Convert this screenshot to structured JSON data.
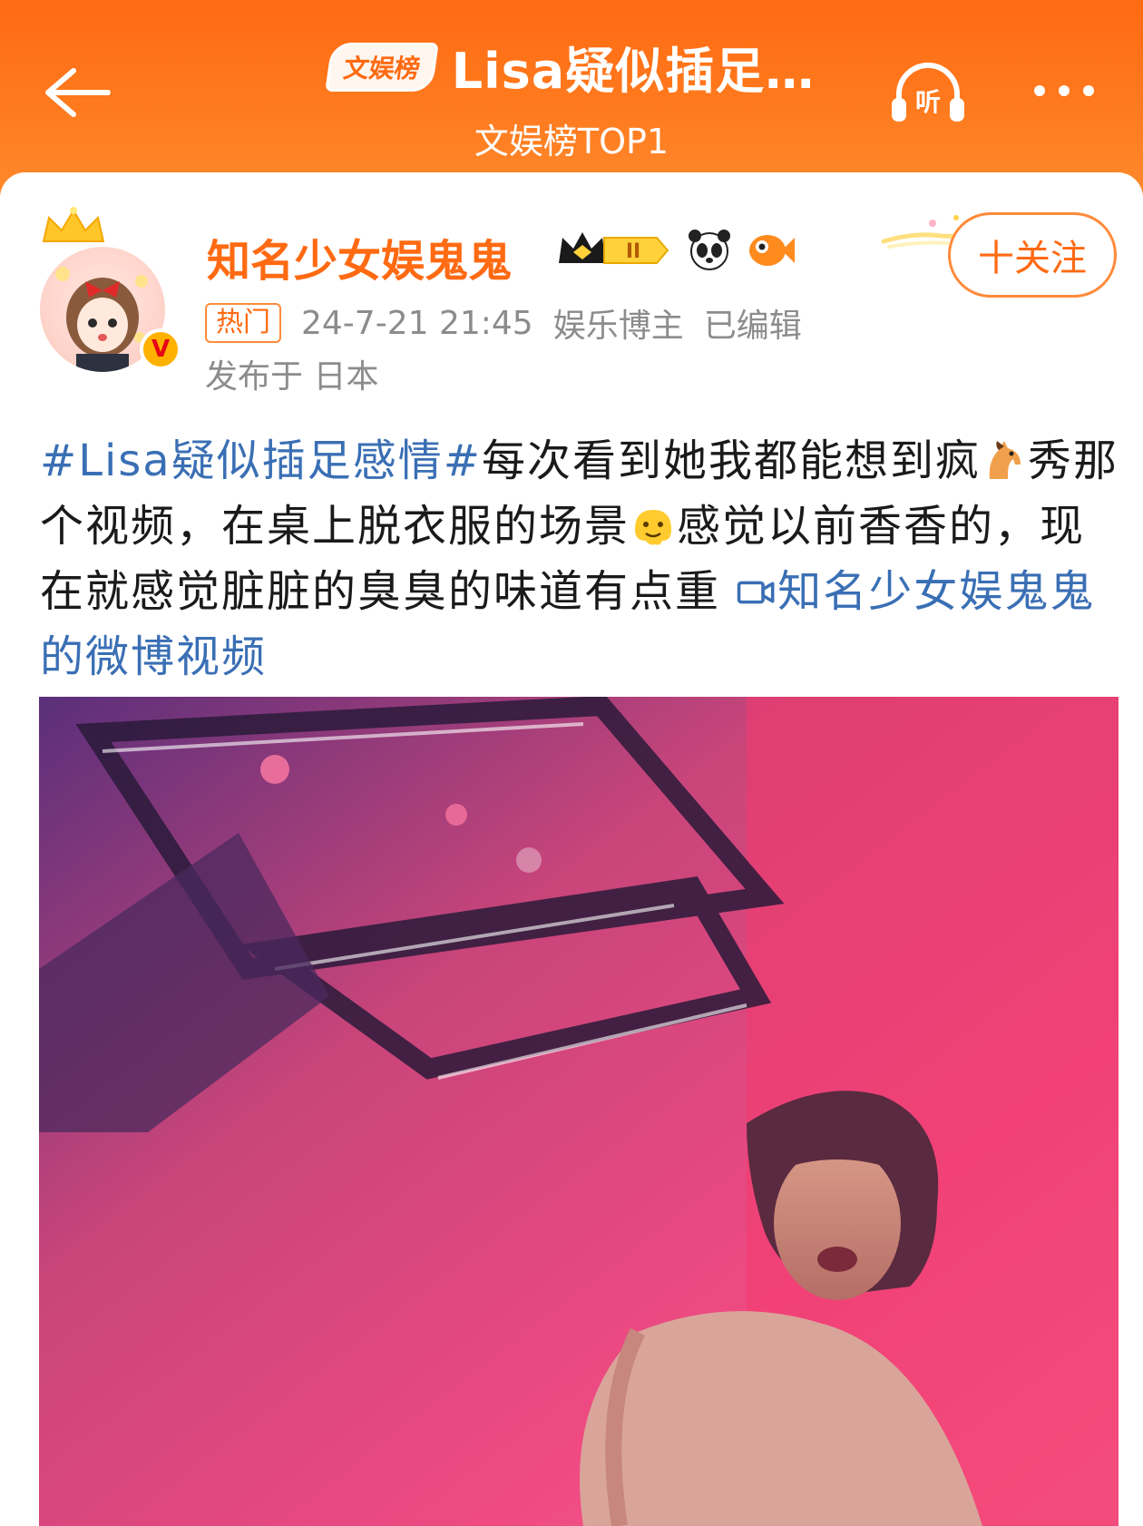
{
  "header": {
    "rank_tag": "文娱榜",
    "title": "Lisa疑似插足…",
    "subtitle": "文娱榜TOP1",
    "listen_label": "听"
  },
  "post": {
    "username": "知名少女娱鬼鬼",
    "level_badge": "II",
    "hot_tag": "热门",
    "datetime": "24-7-21 21:45",
    "role": "娱乐博主",
    "edited": "已编辑",
    "location": "发布于 日本",
    "follow_label": "十关注",
    "avatar_badge": "V",
    "text": {
      "hashtag": "#Lisa疑似插足感情#",
      "part1": "每次看到她我都能想到疯",
      "part2": "秀那个视频，在桌上脱衣服的场景",
      "part3": "感觉以前香香的，现在就感觉脏脏的臭臭的味道有点重",
      "video_link": "知名少女娱鬼鬼的微博视频"
    }
  },
  "colors": {
    "accent": "#ff6a12",
    "link": "#3a6fb4",
    "text": "#1a1a1a",
    "meta": "#8c8c8c"
  },
  "icons": {
    "back": "back-arrow-icon",
    "listen": "headphones-icon",
    "more": "more-dots-icon",
    "video_link": "video-camera-icon"
  }
}
